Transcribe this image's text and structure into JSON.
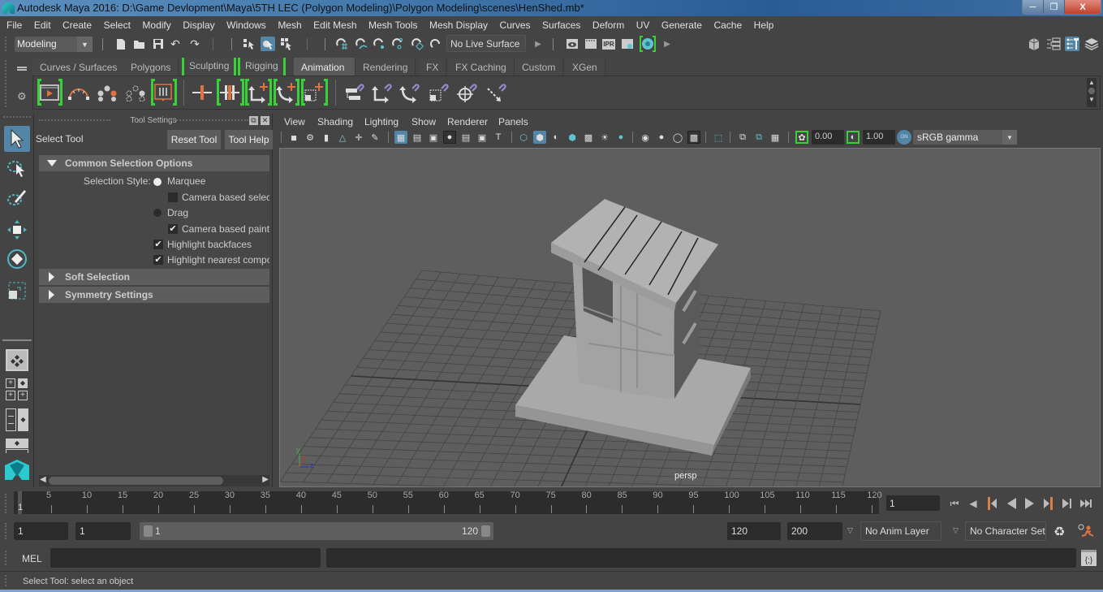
{
  "window": {
    "title": "Autodesk Maya 2016: D:\\Game Devlopment\\Maya\\5TH LEC (Polygon Modeling)\\Polygon Modeling\\scenes\\HenShed.mb*",
    "minimize_icon": "minimize-icon",
    "restore_icon": "restore-icon",
    "close_label": "X"
  },
  "menubar": {
    "items": [
      "File",
      "Edit",
      "Create",
      "Select",
      "Modify",
      "Display",
      "Windows",
      "Mesh",
      "Edit Mesh",
      "Mesh Tools",
      "Mesh Display",
      "Curves",
      "Surfaces",
      "Deform",
      "UV",
      "Generate",
      "Cache",
      "Help"
    ]
  },
  "statusline": {
    "menu_set": "Modeling",
    "live_surface": "No Live Surface",
    "render_icons": [
      "render-view-icon",
      "render-frame-icon",
      "ipr-render-icon",
      "render-settings-icon",
      "hypershade-icon"
    ],
    "ipr_label": "IPR",
    "right_icons": [
      "modeling-toolkit-icon",
      "attribute-editor-icon",
      "tool-settings-icon",
      "channel-box-icon"
    ]
  },
  "shelf": {
    "tabs": [
      {
        "label": "Curves / Surfaces",
        "active": false
      },
      {
        "label": "Polygons",
        "active": false
      },
      {
        "label": "Sculpting",
        "active": false
      },
      {
        "label": "Rigging",
        "active": false
      },
      {
        "label": "Animation",
        "active": true
      },
      {
        "label": "Rendering",
        "active": false
      },
      {
        "label": "FX",
        "active": false
      },
      {
        "label": "FX Caching",
        "active": false
      },
      {
        "label": "Custom",
        "active": false
      },
      {
        "label": "XGen",
        "active": false
      }
    ],
    "icons": [
      "playblast-icon",
      "motion-trail-icon",
      "ghost-icon",
      "unghost-icon",
      "create-clip-icon",
      "set-key-icon",
      "set-breakdown-icon",
      "set-key-translate-icon",
      "set-key-rotate-icon",
      "set-key-scale-icon",
      "parent-constraint-icon",
      "point-constraint-icon",
      "orient-constraint-icon",
      "scale-constraint-icon",
      "aim-constraint-icon",
      "pole-vector-constraint-icon"
    ]
  },
  "toolbox": {
    "tools": [
      "select-tool",
      "lasso-tool",
      "paint-select-tool",
      "move-tool",
      "rotate-tool",
      "scale-tool"
    ]
  },
  "tool_settings": {
    "panel_title": "Tool Settings",
    "tool_name": "Select Tool",
    "reset_button": "Reset Tool",
    "help_button": "Tool Help",
    "sections": {
      "common": "Common Selection Options",
      "soft": "Soft Selection",
      "symmetry": "Symmetry Settings"
    },
    "selection_style_label": "Selection Style:",
    "options": {
      "marquee": {
        "label": "Marquee",
        "selected": true
      },
      "camera_based_selection": {
        "label": "Camera based selecti",
        "checked": false
      },
      "drag": {
        "label": "Drag",
        "selected": false
      },
      "camera_based_paint": {
        "label": "Camera based paint s",
        "checked": true
      },
      "highlight_backfaces": {
        "label": "Highlight backfaces",
        "checked": true
      },
      "highlight_nearest": {
        "label": "Highlight nearest compo",
        "checked": true
      }
    }
  },
  "viewport": {
    "menus": [
      "View",
      "Shading",
      "Lighting",
      "Show",
      "Renderer",
      "Panels"
    ],
    "exposure": "0.00",
    "gamma": "1.00",
    "color_mgmt_label": "ON",
    "color_space": "sRGB gamma",
    "camera": "persp",
    "axis": {
      "x": "x",
      "y": "y",
      "z": "z"
    }
  },
  "timeline": {
    "ticks": [
      "5",
      "10",
      "15",
      "20",
      "25",
      "30",
      "35",
      "40",
      "45",
      "50",
      "55",
      "60",
      "65",
      "70",
      "75",
      "80",
      "85",
      "90",
      "95",
      "100",
      "105",
      "110",
      "115",
      "120"
    ],
    "current_frame_label": "1",
    "current_frame_field": "1",
    "playback_buttons": [
      "go-to-start",
      "step-back-frame",
      "step-back-key",
      "play-backwards",
      "play-forwards",
      "step-forward-key",
      "step-forward-frame",
      "go-to-end"
    ]
  },
  "range": {
    "start_time": "1",
    "playback_start": "1",
    "range_start_label": "1",
    "range_end_label": "120",
    "playback_end": "120",
    "end_time": "200",
    "anim_layer": "No Anim Layer",
    "character_set": "No Character Set"
  },
  "command_line": {
    "language": "MEL",
    "input": "",
    "result": ""
  },
  "help_line": {
    "message": "Select Tool: select an object"
  }
}
